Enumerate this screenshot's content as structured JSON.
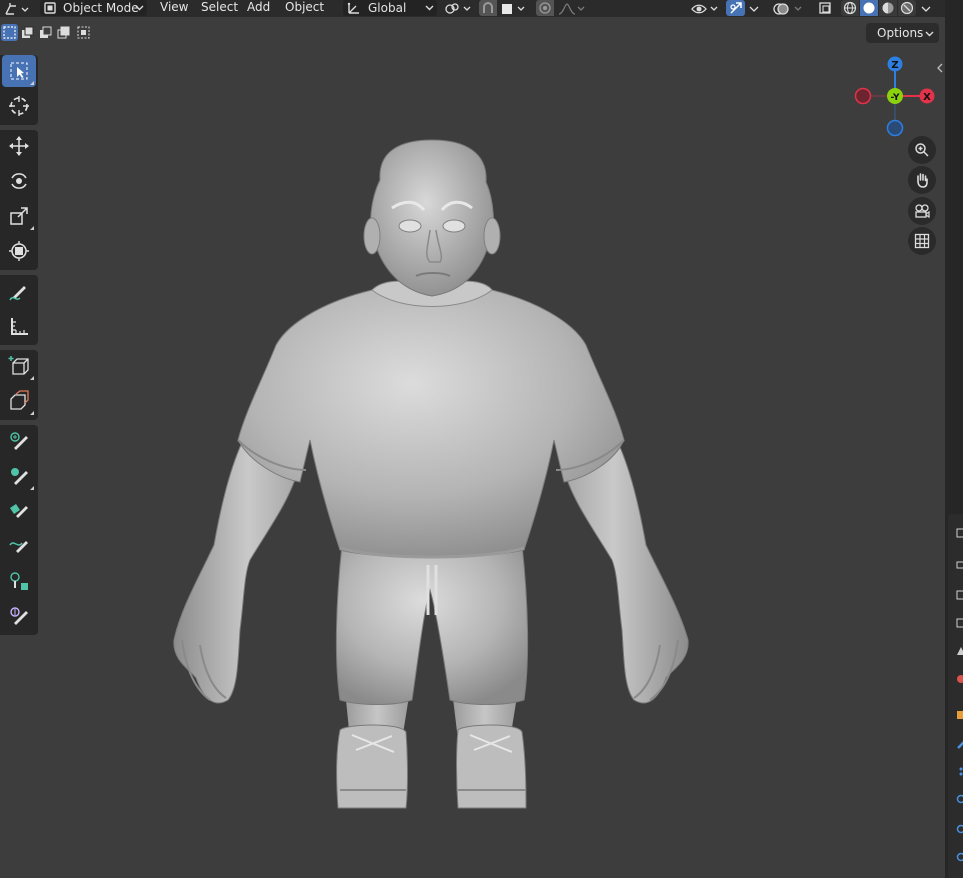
{
  "header": {
    "editor_type_icon": "3d-viewport-icon",
    "mode": {
      "label": "Object Mode",
      "icon": "object-mode-icon"
    },
    "menus": [
      "View",
      "Select",
      "Add",
      "Object"
    ],
    "transform_orientation": {
      "label": "Global",
      "icon": "orientation-icon"
    },
    "pivot_icon": "pivot-point-icon",
    "snap_icon": "snap-icon",
    "snap_target_icon": "snap-target-icon",
    "proportional_icon": "proportional-edit-icon",
    "falloff_icon": "falloff-curve-icon",
    "visibility_icon": "visibility-icon",
    "gizmo_icon": "gizmo-icon",
    "overlay_icon": "overlay-icon",
    "xray_icon": "xray-icon",
    "shading_modes": [
      "wireframe",
      "solid",
      "material-preview",
      "rendered"
    ],
    "active_shading": "solid"
  },
  "selection_modes": [
    "set-new",
    "extend",
    "subtract",
    "intersect"
  ],
  "options_label": "Options",
  "toolbar": {
    "tools": [
      {
        "name": "select-box",
        "active": true
      },
      {
        "name": "cursor"
      },
      {
        "name": "move"
      },
      {
        "name": "rotate"
      },
      {
        "name": "scale"
      },
      {
        "name": "transform"
      },
      {
        "name": "annotate"
      },
      {
        "name": "measure"
      },
      {
        "name": "add-cube"
      },
      {
        "name": "extrude"
      },
      {
        "name": "brush-draw"
      },
      {
        "name": "brush-blob"
      },
      {
        "name": "brush-fill"
      },
      {
        "name": "brush-crease"
      },
      {
        "name": "brush-mask"
      },
      {
        "name": "brush-pose"
      }
    ]
  },
  "nav_gizmo": {
    "axes": {
      "z": "Z",
      "y": "-Y",
      "x": "X"
    },
    "colors": {
      "x": "#e3334a",
      "y": "#8bd10c",
      "z": "#2d7fe0"
    }
  },
  "nav_buttons": [
    "zoom-icon",
    "pan-hand-icon",
    "camera-view-icon",
    "ortho-grid-icon"
  ],
  "viewport": {
    "background": "#3d3d3d",
    "model": "sculpted-character-mesh"
  }
}
